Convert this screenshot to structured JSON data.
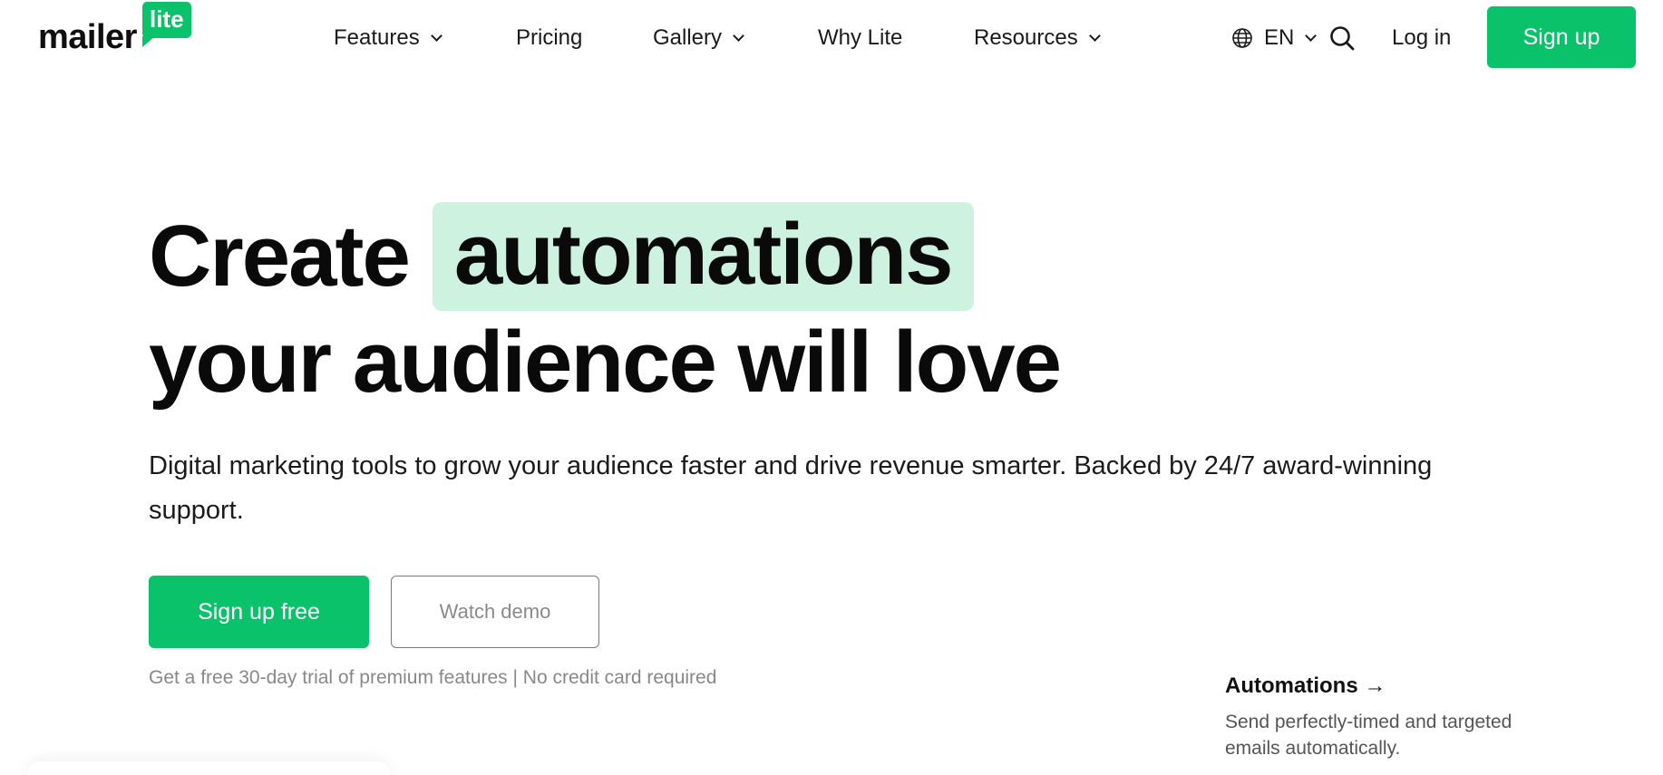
{
  "brand": {
    "name": "mailer",
    "badge": "lite",
    "color": "#09c269"
  },
  "nav": {
    "items": [
      {
        "label": "Features",
        "dropdown": true
      },
      {
        "label": "Pricing",
        "dropdown": false
      },
      {
        "label": "Gallery",
        "dropdown": true
      },
      {
        "label": "Why Lite",
        "dropdown": false
      },
      {
        "label": "Resources",
        "dropdown": true
      }
    ],
    "language": "EN",
    "login": "Log in",
    "signup": "Sign up"
  },
  "hero": {
    "line1_word": "Create",
    "highlight": "automations",
    "line2": "your audience will love",
    "subtitle": "Digital marketing tools to grow your audience faster and drive revenue smarter. Backed by 24/7 award-winning support.",
    "primary_cta": "Sign up free",
    "secondary_cta": "Watch demo",
    "note": "Get a free 30-day trial of premium features | No credit card required"
  },
  "feature": {
    "title": "Automations →",
    "description": "Send perfectly-timed and targeted emails automatically."
  },
  "colors": {
    "accent": "#09c269",
    "highlight_bg": "#cdf3e0"
  }
}
